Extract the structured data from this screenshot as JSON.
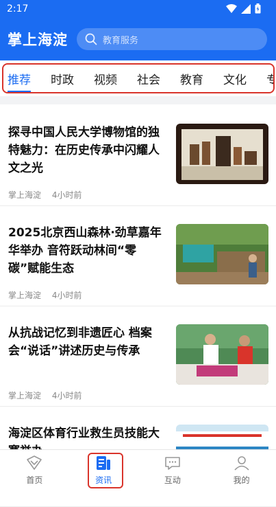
{
  "status": {
    "time": "2:17"
  },
  "header": {
    "brand": "掌上海淀",
    "search_placeholder": "教育服务"
  },
  "tabs": [
    "推荐",
    "时政",
    "视频",
    "社会",
    "教育",
    "文化",
    "专题"
  ],
  "active_tab": "推荐",
  "articles": [
    {
      "title": "探寻中国人民大学博物馆的独特魅力：在历史传承中闪耀人文之光",
      "source": "掌上海淀",
      "time": "4小时前"
    },
    {
      "title": "2025北京西山森林·劲草嘉年华举办 音符跃动林间“零碳”赋能生态",
      "source": "掌上海淀",
      "time": "4小时前"
    },
    {
      "title": "从抗战记忆到非遗匠心 档案会“说话”讲述历史与传承",
      "source": "掌上海淀",
      "time": "4小时前"
    },
    {
      "title": "海淀区体育行业救生员技能大赛举办",
      "source": "",
      "time": ""
    }
  ],
  "bottom_nav": [
    {
      "label": "首页",
      "icon": "home-icon"
    },
    {
      "label": "资讯",
      "icon": "news-icon"
    },
    {
      "label": "互动",
      "icon": "chat-icon"
    },
    {
      "label": "我的",
      "icon": "profile-icon"
    }
  ],
  "colors": {
    "brand_blue": "#1b6cf2",
    "highlight_red": "#d9342b"
  }
}
